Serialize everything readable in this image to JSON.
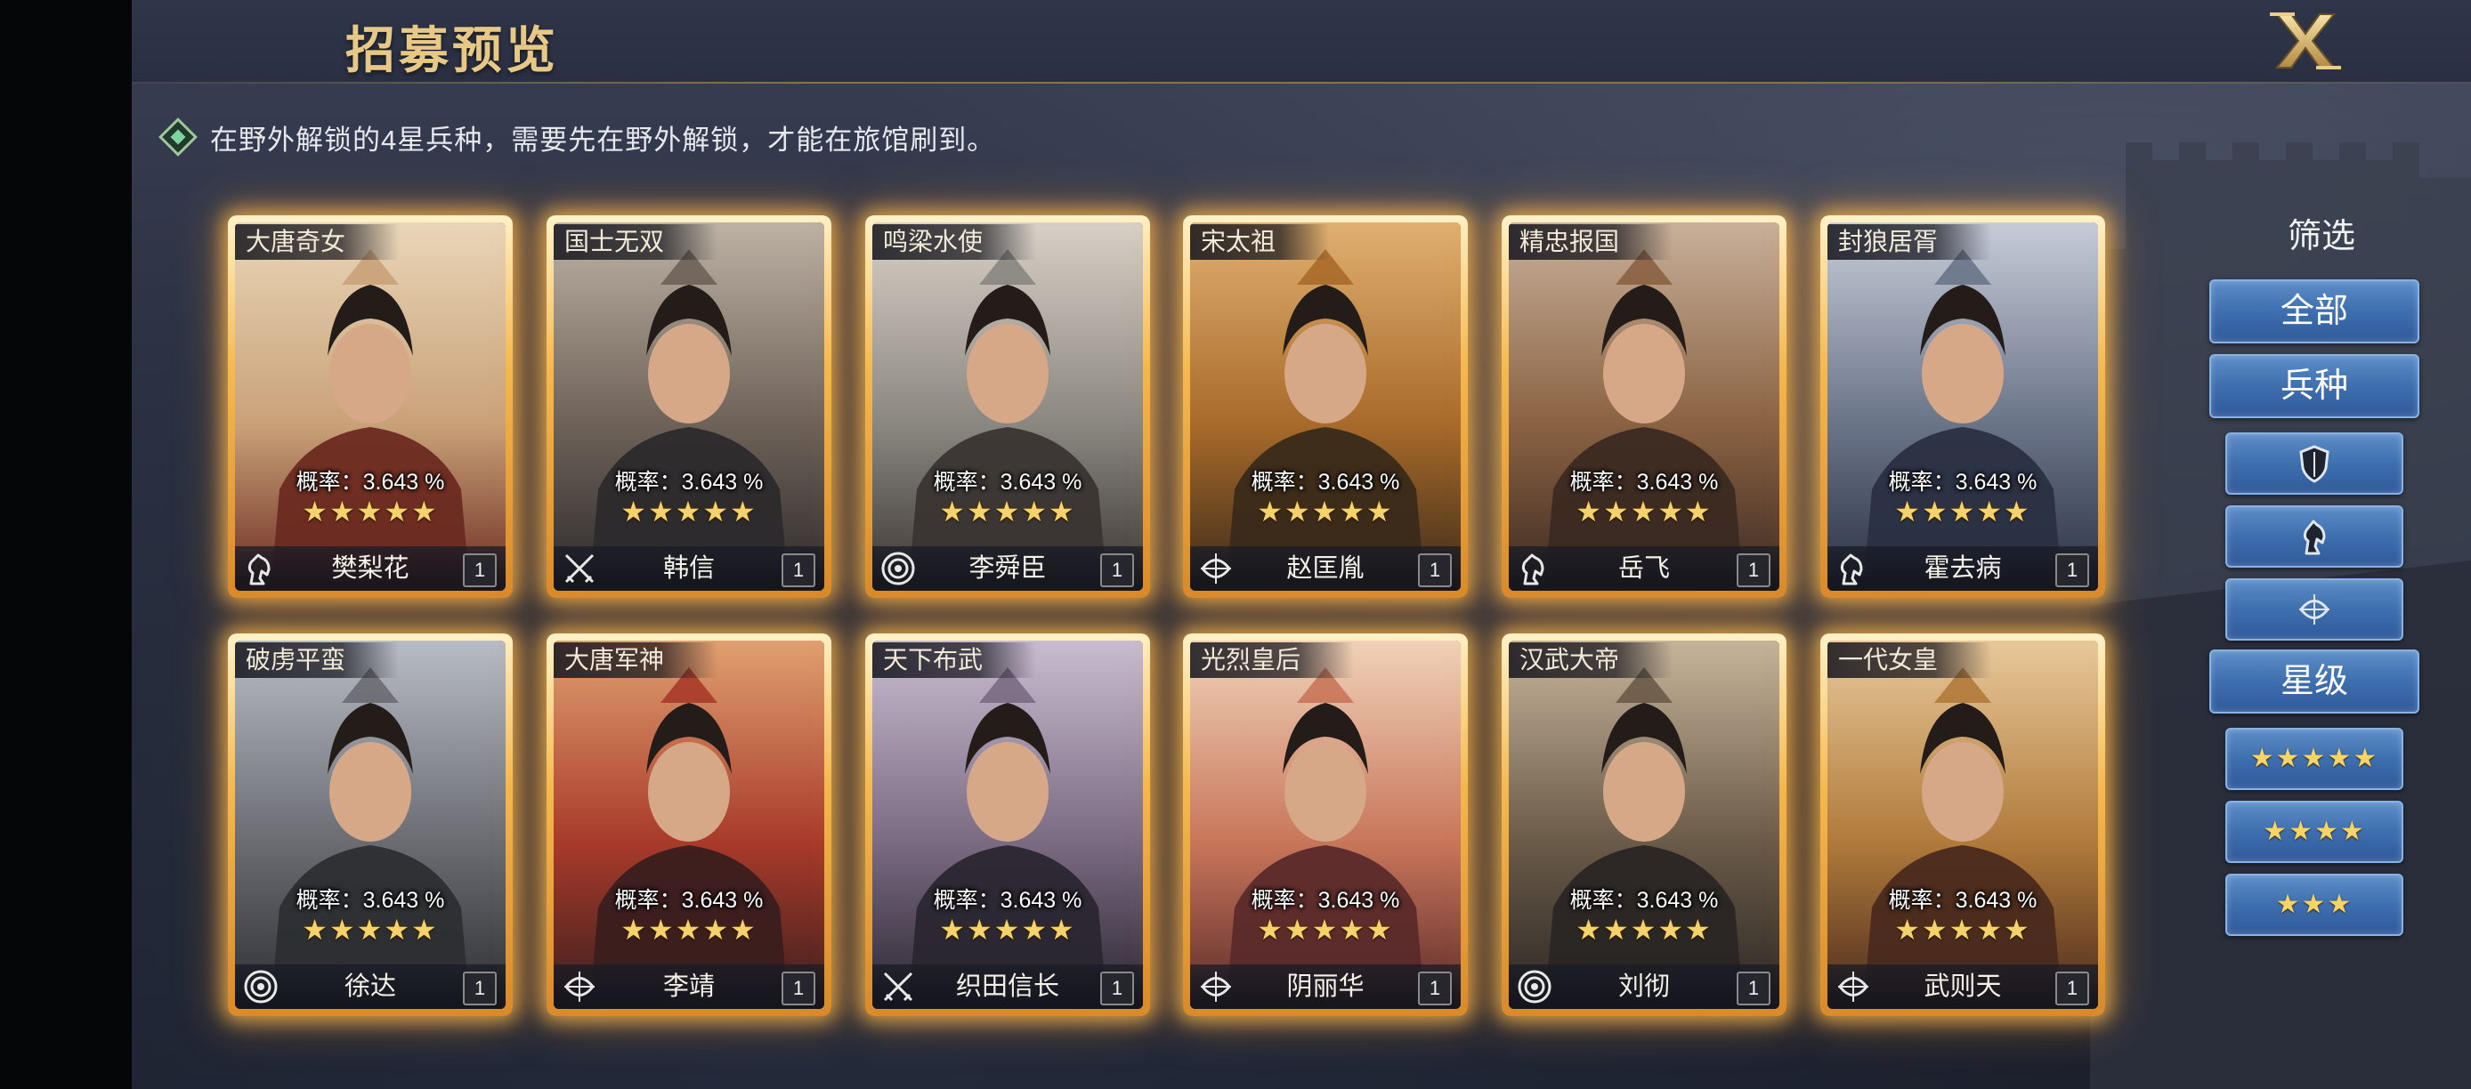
{
  "header": {
    "title": "招募预览"
  },
  "notice": {
    "text": "在野外解锁的4星兵种，需要先在野外解锁，才能在旅馆刷到。"
  },
  "cards": [
    {
      "title": "大唐奇女",
      "rate": "概率：3.643 %",
      "stars": "★★★★★",
      "name": "樊梨花",
      "count": "1",
      "type_icon": "cavalry-icon"
    },
    {
      "title": "国士无双",
      "rate": "概率：3.643 %",
      "stars": "★★★★★",
      "name": "韩信",
      "count": "1",
      "type_icon": "crossed-swords-icon"
    },
    {
      "title": "鸣梁水使",
      "rate": "概率：3.643 %",
      "stars": "★★★★★",
      "name": "李舜臣",
      "count": "1",
      "type_icon": "target-icon"
    },
    {
      "title": "宋太祖",
      "rate": "概率：3.643 %",
      "stars": "★★★★★",
      "name": "赵匡胤",
      "count": "1",
      "type_icon": "bow-icon"
    },
    {
      "title": "精忠报国",
      "rate": "概率：3.643 %",
      "stars": "★★★★★",
      "name": "岳飞",
      "count": "1",
      "type_icon": "cavalry-icon"
    },
    {
      "title": "封狼居胥",
      "rate": "概率：3.643 %",
      "stars": "★★★★★",
      "name": "霍去病",
      "count": "1",
      "type_icon": "cavalry-icon"
    },
    {
      "title": "破虏平蛮",
      "rate": "概率：3.643 %",
      "stars": "★★★★★",
      "name": "徐达",
      "count": "1",
      "type_icon": "target-icon"
    },
    {
      "title": "大唐军神",
      "rate": "概率：3.643 %",
      "stars": "★★★★★",
      "name": "李靖",
      "count": "1",
      "type_icon": "bow-icon"
    },
    {
      "title": "天下布武",
      "rate": "概率：3.643 %",
      "stars": "★★★★★",
      "name": "织田信长",
      "count": "1",
      "type_icon": "crossed-swords-icon"
    },
    {
      "title": "光烈皇后",
      "rate": "概率：3.643 %",
      "stars": "★★★★★",
      "name": "阴丽华",
      "count": "1",
      "type_icon": "bow-icon"
    },
    {
      "title": "汉武大帝",
      "rate": "概率：3.643 %",
      "stars": "★★★★★",
      "name": "刘彻",
      "count": "1",
      "type_icon": "target-icon"
    },
    {
      "title": "一代女皇",
      "rate": "概率：3.643 %",
      "stars": "★★★★★",
      "name": "武则天",
      "count": "1",
      "type_icon": "bow-icon"
    }
  ],
  "filter": {
    "title": "筛选",
    "all_label": "全部",
    "troop_label": "兵种",
    "troop_icons": [
      "shield-icon",
      "horse-icon",
      "bow-icon"
    ],
    "star_label": "星级",
    "star_options": [
      "★★★★★",
      "★★★★",
      "★★★"
    ]
  },
  "colors": {
    "title_gold": "#e8c886",
    "card_glow": "#f5b94f",
    "filter_blue": "#3e6fae"
  }
}
